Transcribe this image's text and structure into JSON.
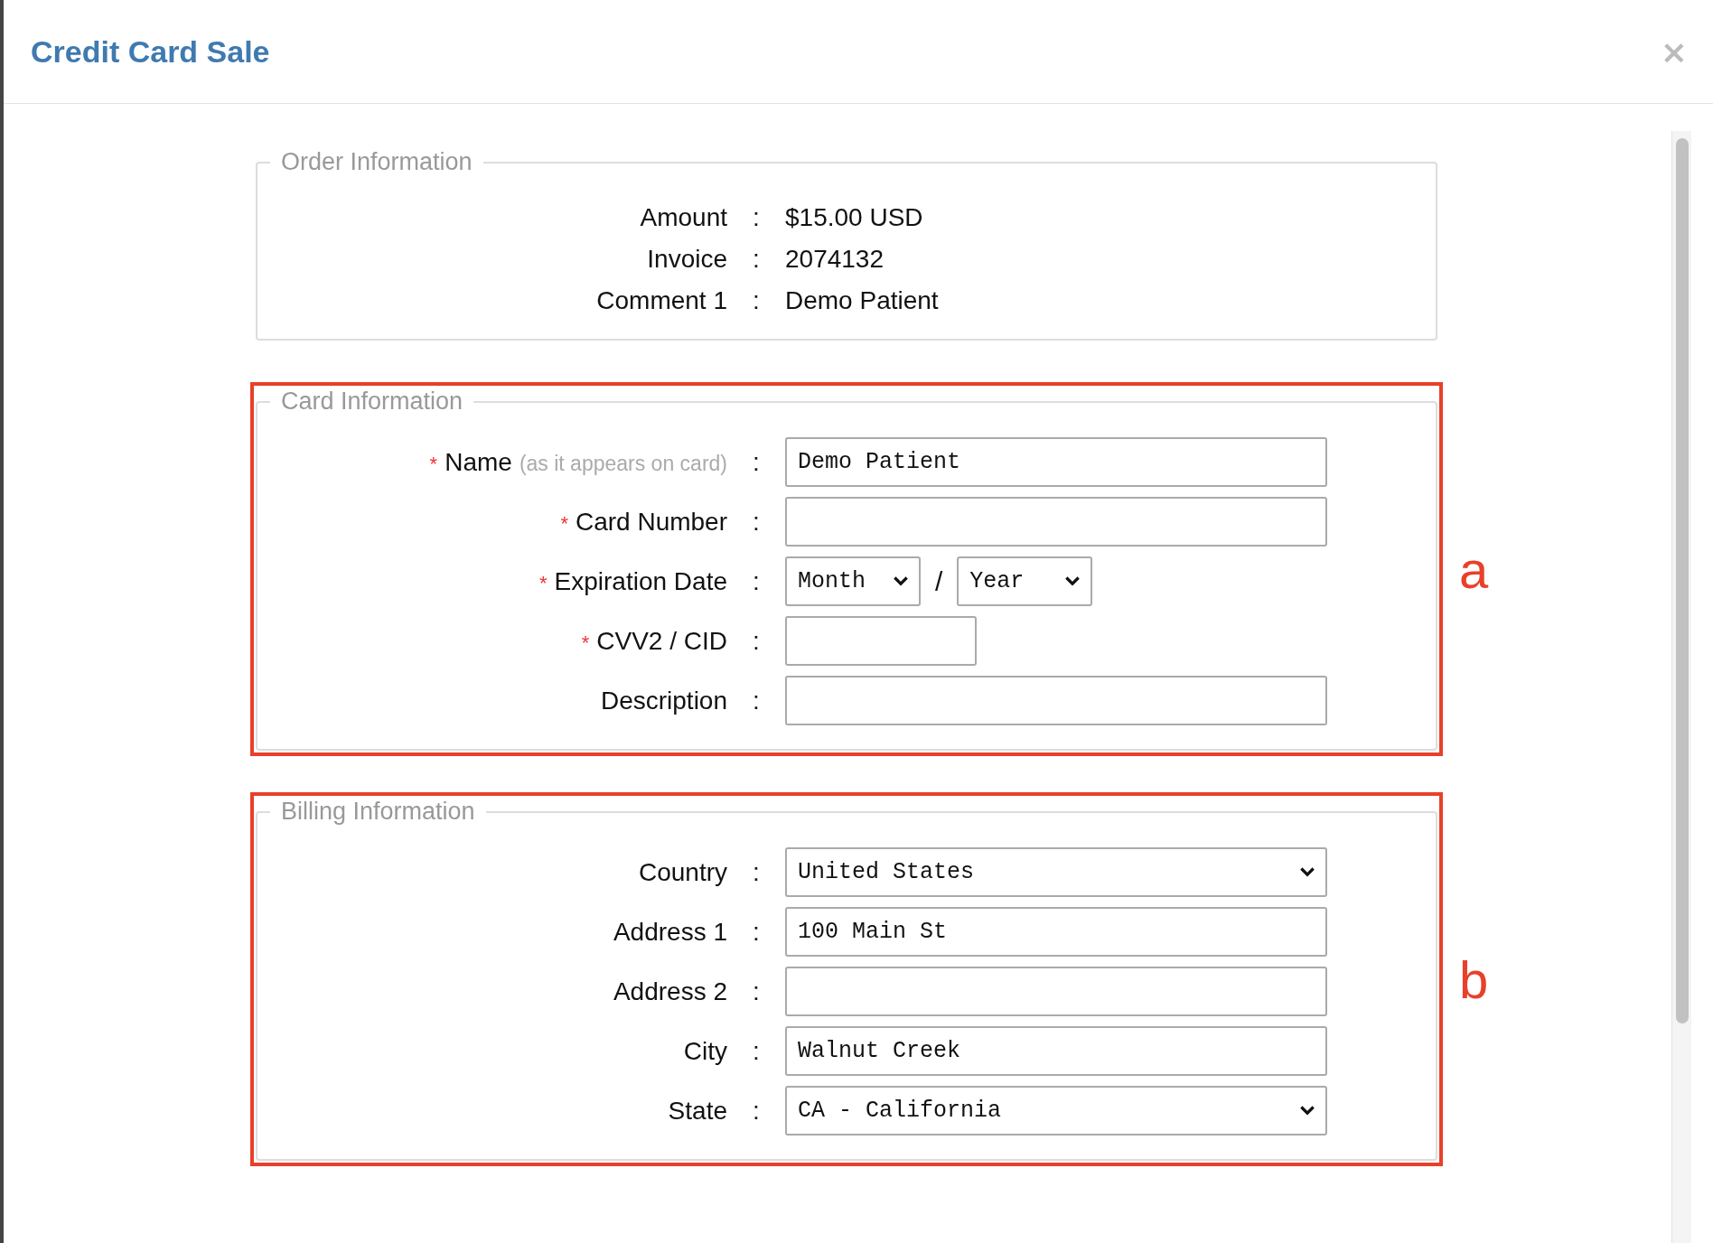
{
  "dialog": {
    "title": "Credit Card Sale",
    "close": "×"
  },
  "sections": [
    {
      "legend": "Order Information",
      "kind": "info",
      "rows": [
        {
          "label": "Amount",
          "separator": ":",
          "value": "$15.00 USD"
        },
        {
          "label": "Invoice",
          "separator": ":",
          "value": "2074132"
        },
        {
          "label": "Comment 1",
          "separator": ":",
          "value": "Demo Patient"
        }
      ]
    },
    {
      "legend": "Card Information",
      "kind": "form",
      "annotation": "a",
      "rows": [
        {
          "kind": "text",
          "required_mark": "*",
          "label": "Name",
          "hint": "(as it appears on card)",
          "separator": ":",
          "value": "Demo Patient"
        },
        {
          "kind": "text",
          "required_mark": "*",
          "label": "Card Number",
          "separator": ":"
        },
        {
          "kind": "expiry",
          "required_mark": "*",
          "label": "Expiration Date",
          "separator": ":",
          "month": "Month",
          "divider": "/",
          "year": "Year"
        },
        {
          "kind": "short",
          "required_mark": "*",
          "label": "CVV2 / CID",
          "separator": ":"
        },
        {
          "kind": "text",
          "label": "Description",
          "separator": ":"
        }
      ]
    },
    {
      "legend": "Billing Information",
      "kind": "form",
      "annotation": "b",
      "rows": [
        {
          "kind": "select",
          "label": "Country",
          "separator": ":",
          "value": "United States"
        },
        {
          "kind": "text",
          "label": "Address 1",
          "separator": ":",
          "value": "100 Main St"
        },
        {
          "kind": "text",
          "label": "Address 2",
          "separator": ":"
        },
        {
          "kind": "text",
          "label": "City",
          "separator": ":",
          "value": "Walnut Creek"
        },
        {
          "kind": "select",
          "label": "State",
          "separator": ":",
          "value": "CA - California"
        }
      ]
    }
  ]
}
